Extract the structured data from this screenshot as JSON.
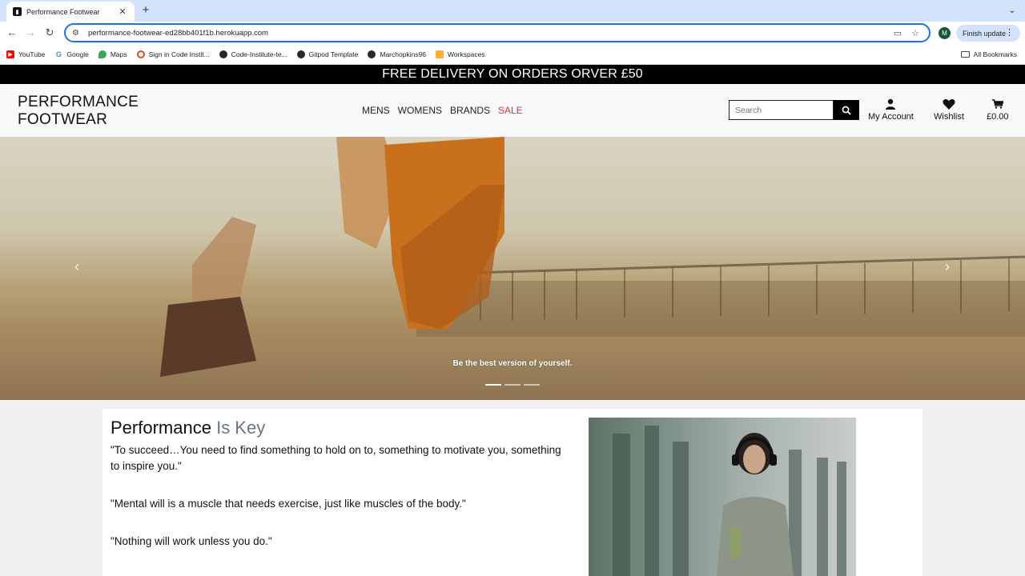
{
  "browser": {
    "tab_title": "Performance Footwear",
    "url": "performance-footwear-ed28bb401f1b.herokuapp.com",
    "profile_initial": "M",
    "finish_update": "Finish update",
    "bookmarks": [
      {
        "label": "YouTube",
        "icon": "youtube-icon",
        "color": "#ff0000"
      },
      {
        "label": "Google",
        "icon": "google-icon",
        "color": "#4285f4"
      },
      {
        "label": "Maps",
        "icon": "maps-icon",
        "color": "#34a853"
      },
      {
        "label": "Sign in Code Instit...",
        "icon": "code-institute-icon",
        "color": "#e8491d"
      },
      {
        "label": "Code-Institute-te...",
        "icon": "github-icon",
        "color": "#24292f"
      },
      {
        "label": "Gitpod Template",
        "icon": "github-icon",
        "color": "#24292f"
      },
      {
        "label": "Marchopkins96",
        "icon": "github-icon",
        "color": "#24292f"
      },
      {
        "label": "Workspaces",
        "icon": "gitpod-icon",
        "color": "#ffae33"
      }
    ],
    "all_bookmarks": "All Bookmarks"
  },
  "site": {
    "promo": "FREE DELIVERY ON ORDERS ORVER £50",
    "logo_line1": "PERFORMANCE",
    "logo_line2": "FOOTWEAR",
    "nav": {
      "mens": "MENS",
      "womens": "WOMENS",
      "brands": "BRANDS",
      "sale": "SALE"
    },
    "search_placeholder": "Search",
    "account": "My Account",
    "wishlist": "Wishlist",
    "basket_total": "£0.00",
    "hero_caption": "Be the best version of yourself.",
    "carousel_slides": 3,
    "carousel_active": 1,
    "heading_main": "Performance",
    "heading_accent": "Is Key",
    "quotes": [
      "\"To succeed…You need to find something to hold on to, something to motivate you, something to inspire you.\"",
      "\"Mental will is a muscle that needs exercise, just like muscles of the body.\"",
      "\"Nothing will work unless you do.\""
    ],
    "colors": {
      "sale": "#dc3545",
      "promo_bg": "#000000",
      "header_bg": "#f8f9fa"
    }
  }
}
